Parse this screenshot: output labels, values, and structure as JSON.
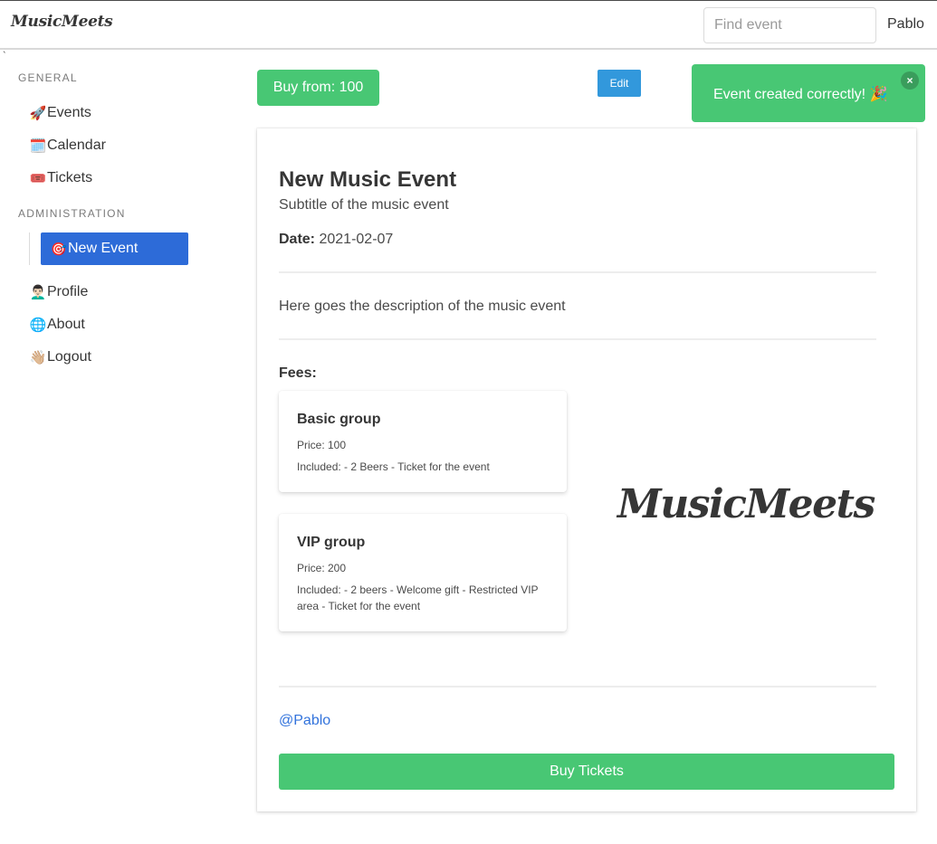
{
  "navbar": {
    "brand": "MusicMeets",
    "search_placeholder": "Find event",
    "user": "Pablo",
    "tick": "`"
  },
  "sidebar": {
    "general_label": "GENERAL",
    "general_items": [
      {
        "icon": "rocket-icon",
        "emoji": "🚀",
        "label": "Events"
      },
      {
        "icon": "calendar-icon",
        "emoji": "🗓️",
        "label": "Calendar"
      },
      {
        "icon": "ticket-icon",
        "emoji": "🎟️",
        "label": "Tickets"
      }
    ],
    "admin_label": "ADMINISTRATION",
    "active_item": {
      "icon": "target-icon",
      "emoji": "🎯",
      "label": "New Event"
    },
    "other_items": [
      {
        "icon": "person-icon",
        "emoji": "👨🏻‍🦱",
        "label": "Profile"
      },
      {
        "icon": "globe-icon",
        "emoji": "🌐",
        "label": "About"
      },
      {
        "icon": "wave-icon",
        "emoji": "👋🏼",
        "label": "Logout"
      }
    ]
  },
  "actions": {
    "buy_from": "Buy from: 100",
    "edit": "Edit"
  },
  "toast": {
    "message": "Event created correctly! 🎉",
    "close": "×"
  },
  "event": {
    "title": "New Music Event",
    "subtitle": "Subtitle of the music event",
    "date_label": "Date:",
    "date_value": "2021-02-07",
    "description": "Here goes the description of the music event",
    "fees_label": "Fees:",
    "fees": [
      {
        "name": "Basic group",
        "price": "Price: 100",
        "included": "Included: - 2 Beers - Ticket for the event"
      },
      {
        "name": "VIP group",
        "price": "Price: 200",
        "included": "Included: - 2 beers - Welcome gift - Restricted VIP area - Ticket for the event"
      }
    ],
    "logo": "MusicMeets",
    "author": "@Pablo",
    "buy_button": "Buy Tickets"
  },
  "colors": {
    "success": "#48c774",
    "info": "#3298dc",
    "active": "#2d6bd8",
    "link": "#3273dc"
  }
}
